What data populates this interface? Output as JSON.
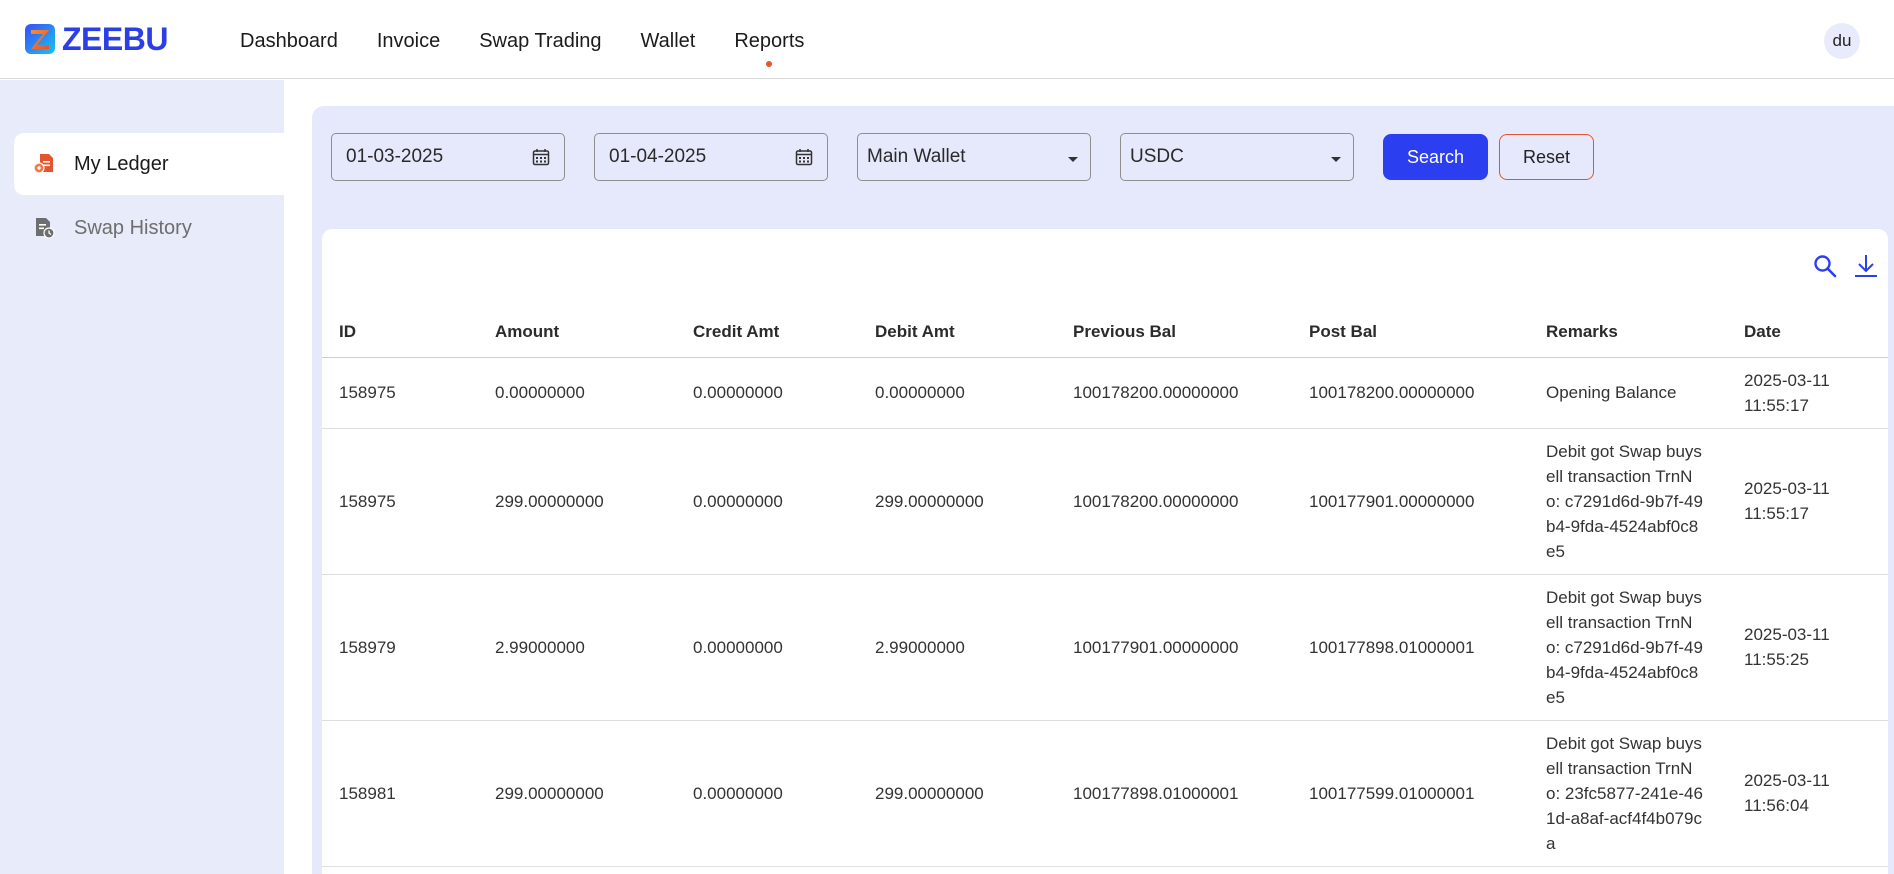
{
  "app": {
    "logo_text": "ZEEBU",
    "brand_color": "#2c3fe6",
    "accent_color": "#e2552f"
  },
  "nav": {
    "items": [
      {
        "label": "Dashboard"
      },
      {
        "label": "Invoice"
      },
      {
        "label": "Swap Trading"
      },
      {
        "label": "Wallet"
      },
      {
        "label": "Reports",
        "active": true
      }
    ]
  },
  "user": {
    "initials": "du"
  },
  "sidebar": {
    "items": [
      {
        "label": "My Ledger",
        "icon": "ledger-icon",
        "active": true
      },
      {
        "label": "Swap History",
        "icon": "swap-history-icon",
        "active": false
      }
    ]
  },
  "filters": {
    "from_date": "01-03-2025",
    "to_date": "01-04-2025",
    "wallet": "Main Wallet",
    "currency": "USDC",
    "search_label": "Search",
    "reset_label": "Reset"
  },
  "table": {
    "columns": [
      "ID",
      "Amount",
      "Credit Amt",
      "Debit Amt",
      "Previous Bal",
      "Post Bal",
      "Remarks",
      "Date"
    ],
    "rows": [
      [
        "158975",
        "0.00000000",
        "0.00000000",
        "0.00000000",
        "100178200.00000000",
        "100178200.00000000",
        "Opening Balance",
        "2025-03-11 11:55:17"
      ],
      [
        "158975",
        "299.00000000",
        "0.00000000",
        "299.00000000",
        "100178200.00000000",
        "100177901.00000000",
        "Debit got Swap buysell transaction TrnNo: c7291d6d-9b7f-49b4-9fda-4524abf0c8e5",
        "2025-03-11 11:55:17"
      ],
      [
        "158979",
        "2.99000000",
        "0.00000000",
        "2.99000000",
        "100177901.00000000",
        "100177898.01000001",
        "Debit got Swap buysell transaction TrnNo: c7291d6d-9b7f-49b4-9fda-4524abf0c8e5",
        "2025-03-11 11:55:25"
      ],
      [
        "158981",
        "299.00000000",
        "0.00000000",
        "299.00000000",
        "100177898.01000001",
        "100177599.01000001",
        "Debit got Swap buysell transaction TrnNo: 23fc5877-241e-461d-a8af-acf4f4b079ca",
        "2025-03-11 11:56:04"
      ]
    ]
  }
}
